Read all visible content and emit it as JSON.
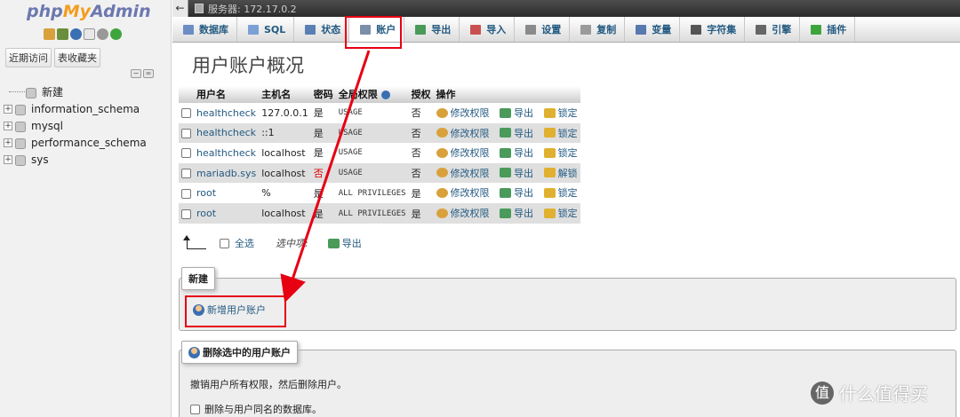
{
  "app": {
    "logo": {
      "part1": "php",
      "part2": "My",
      "part3": "Admin"
    }
  },
  "sidebar": {
    "buttons": [
      "近期访问",
      "表收藏夹"
    ],
    "tree": [
      {
        "label": "新建",
        "expandable": false
      },
      {
        "label": "information_schema",
        "expandable": true
      },
      {
        "label": "mysql",
        "expandable": true
      },
      {
        "label": "performance_schema",
        "expandable": true
      },
      {
        "label": "sys",
        "expandable": true
      }
    ]
  },
  "serverbar": {
    "label": "服务器: 172.17.0.2"
  },
  "tabs": [
    {
      "label": "数据库",
      "icon": "database-icon",
      "color": "#6b8cc4"
    },
    {
      "label": "SQL",
      "icon": "sql-icon",
      "color": "#7aa0d6"
    },
    {
      "label": "状态",
      "icon": "status-icon",
      "color": "#5a7fb5"
    },
    {
      "label": "账户",
      "icon": "accounts-icon",
      "color": "#7b8fa8",
      "active": true
    },
    {
      "label": "导出",
      "icon": "export-icon",
      "color": "#4a9a5a"
    },
    {
      "label": "导入",
      "icon": "import-icon",
      "color": "#c95050"
    },
    {
      "label": "设置",
      "icon": "settings-icon",
      "color": "#8a8a8a"
    },
    {
      "label": "复制",
      "icon": "replication-icon",
      "color": "#9a9a9a"
    },
    {
      "label": "变量",
      "icon": "variables-icon",
      "color": "#5878b0"
    },
    {
      "label": "字符集",
      "icon": "charset-icon",
      "color": "#555555"
    },
    {
      "label": "引擎",
      "icon": "engine-icon",
      "color": "#666666"
    },
    {
      "label": "插件",
      "icon": "plugin-icon",
      "color": "#3ea53e"
    }
  ],
  "main": {
    "title": "用户账户概况",
    "table": {
      "headers": [
        "用户名",
        "主机名",
        "密码",
        "全局权限",
        "授权",
        "操作"
      ],
      "actions": {
        "edit": "修改权限",
        "export": "导出",
        "lock": "锁定",
        "unlock": "解锁"
      },
      "rows": [
        {
          "user": "healthcheck",
          "host": "127.0.0.1",
          "password": "是",
          "privileges": "USAGE",
          "grant": "否",
          "lock": "锁定"
        },
        {
          "user": "healthcheck",
          "host": "::1",
          "password": "是",
          "privileges": "USAGE",
          "grant": "否",
          "lock": "锁定"
        },
        {
          "user": "healthcheck",
          "host": "localhost",
          "password": "是",
          "privileges": "USAGE",
          "grant": "否",
          "lock": "锁定"
        },
        {
          "user": "mariadb.sys",
          "host": "localhost",
          "password": "否",
          "privileges": "USAGE",
          "grant": "否",
          "lock": "解锁"
        },
        {
          "user": "root",
          "host": "%",
          "password": "是",
          "privileges": "ALL PRIVILEGES",
          "grant": "是",
          "lock": "锁定"
        },
        {
          "user": "root",
          "host": "localhost",
          "password": "是",
          "privileges": "ALL PRIVILEGES",
          "grant": "是",
          "lock": "锁定"
        }
      ]
    },
    "with_selected": {
      "check_all": "全选",
      "label": "选中项:",
      "export": "导出"
    },
    "new_section": {
      "legend": "新建",
      "add_user": "新增用户账户"
    },
    "delete_section": {
      "legend": "删除选中的用户账户",
      "description": "撤销用户所有权限，然后删除用户。",
      "drop_db_label": "删除与用户同名的数据库。"
    }
  },
  "watermark": {
    "text": "什么值得买",
    "icon_glyph": "值"
  },
  "colors": {
    "annotation_red": "#e60012",
    "link": "#235a81"
  }
}
